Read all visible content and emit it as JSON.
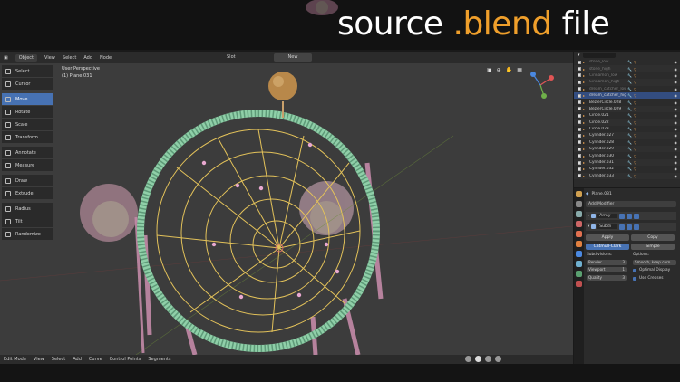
{
  "banner": {
    "title_main": "source ",
    "title_accent": ".blend",
    "title_end": " file"
  },
  "header": {
    "mode": "Object",
    "menus": [
      "View",
      "Select",
      "Add",
      "Node"
    ],
    "slot": "Slot",
    "new_label": "New"
  },
  "viewport": {
    "perspective": "User Perspective",
    "object_info": "(1) Plane.031"
  },
  "toolbar": {
    "tools": [
      "Select",
      "Cursor",
      "Move",
      "Rotate",
      "Scale",
      "Transform",
      "Annotate",
      "Measure",
      "Draw",
      "Extrude",
      "Radius",
      "Tilt",
      "Randomize"
    ],
    "active": "Move"
  },
  "statusbar": {
    "mode": "Edit Mode",
    "menus": [
      "View",
      "Select",
      "Add",
      "Curve",
      "Control Points",
      "Segments"
    ]
  },
  "outliner": {
    "rows": [
      {
        "label": "stone_low",
        "dim": true
      },
      {
        "label": "stone_high",
        "dim": true
      },
      {
        "label": "Cinnamon_low",
        "dim": true
      },
      {
        "label": "Cinnamon_high",
        "dim": true
      },
      {
        "label": "dream_catcher_low",
        "dim": true
      },
      {
        "label": "dream_catcher_high",
        "dim": false,
        "selected": true
      },
      {
        "label": "BezierCircle.028",
        "dim": false
      },
      {
        "label": "BezierCircle.029",
        "dim": false
      },
      {
        "label": "Circle.021",
        "dim": false
      },
      {
        "label": "Circle.022",
        "dim": false
      },
      {
        "label": "Circle.023",
        "dim": false
      },
      {
        "label": "Cylinder.027",
        "dim": false
      },
      {
        "label": "Cylinder.028",
        "dim": false
      },
      {
        "label": "Cylinder.029",
        "dim": false
      },
      {
        "label": "Cylinder.030",
        "dim": false
      },
      {
        "label": "Cylinder.031",
        "dim": false
      },
      {
        "label": "Cylinder.032",
        "dim": false
      },
      {
        "label": "Cylinder.033",
        "dim": false
      }
    ]
  },
  "properties": {
    "object_name": "Plane.031",
    "add_modifier": "Add Modifier",
    "modifier1": "Array",
    "modifier2": "Subdi",
    "apply": "Apply",
    "copy": "Copy",
    "catmull": "Catmull-Clark",
    "simple": "Simple",
    "subdivisions_label": "Subdivisions:",
    "options_label": "Options:",
    "render_label": "Render",
    "render_val": "3",
    "viewport_label": "Viewport",
    "viewport_val": "1",
    "quality_label": "Quality",
    "quality_val": "3",
    "smooth_option": "Smooth, keep corn…",
    "optimal_display": "Optimal Display",
    "use_creases": "Use Creases"
  }
}
